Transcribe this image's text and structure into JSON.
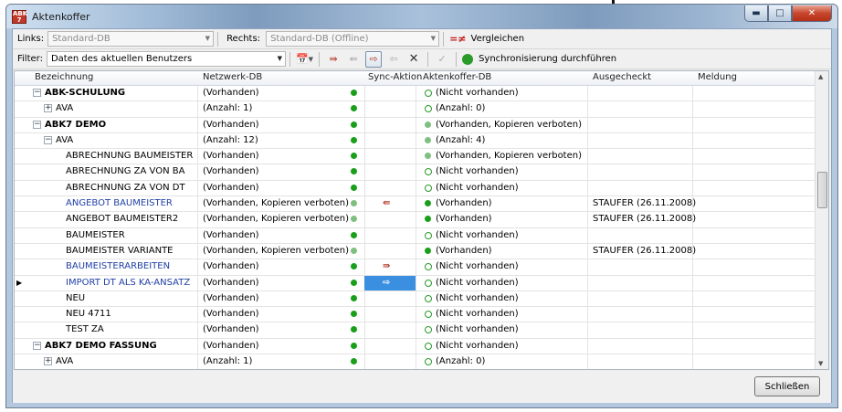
{
  "window": {
    "title": "Aktenkoffer",
    "icon": "abk-app-icon",
    "min": "▬",
    "max": "□",
    "close": "✕"
  },
  "toolbar": {
    "links_label": "Links:",
    "links_value": "Standard-DB",
    "rechts_label": "Rechts:",
    "rechts_value": "Standard-DB (Offline)",
    "compare_label": "Vergleichen",
    "compare_glyph": "=≠",
    "filter_label": "Filter:",
    "filter_value": "Daten des aktuellen Benutzers",
    "sync_label": "Synchronisierung durchführen"
  },
  "columns": [
    "Bezeichnung",
    "Netzwerk-DB",
    "Sync-Aktion",
    "Aktenkoffer-DB",
    "Ausgecheckt",
    "Meldung"
  ],
  "rows": [
    {
      "name": "ABK-SCHULUNG",
      "level": 0,
      "toggle": "⊟",
      "style": "bold",
      "net": "(Vorhanden)",
      "net_dot": "g",
      "sync": "",
      "sync_active": false,
      "ak": "(Nicht vorhanden)",
      "ak_dot": "ring",
      "out": "",
      "msg": ""
    },
    {
      "name": "AVA",
      "level": 1,
      "toggle": "⊞",
      "style": "",
      "net": "(Anzahl: 1)",
      "net_dot": "g",
      "sync": "",
      "sync_active": false,
      "ak": "(Anzahl: 0)",
      "ak_dot": "ring",
      "out": "",
      "msg": ""
    },
    {
      "name": "ABK7 DEMO",
      "level": 0,
      "toggle": "⊟",
      "style": "bold",
      "net": "(Vorhanden)",
      "net_dot": "g",
      "sync": "",
      "sync_active": false,
      "ak": "(Vorhanden, Kopieren verboten)",
      "ak_dot": "p",
      "out": "",
      "msg": ""
    },
    {
      "name": "AVA",
      "level": 1,
      "toggle": "⊟",
      "style": "",
      "net": "(Anzahl: 12)",
      "net_dot": "g",
      "sync": "",
      "sync_active": false,
      "ak": "(Anzahl: 4)",
      "ak_dot": "p",
      "out": "",
      "msg": ""
    },
    {
      "name": "ABRECHNUNG BAUMEISTER",
      "level": 2,
      "toggle": "",
      "style": "",
      "net": "(Vorhanden)",
      "net_dot": "g",
      "sync": "",
      "sync_active": false,
      "ak": "(Vorhanden, Kopieren verboten)",
      "ak_dot": "p",
      "out": "",
      "msg": ""
    },
    {
      "name": "ABRECHNUNG ZA VON BA",
      "level": 2,
      "toggle": "",
      "style": "",
      "net": "(Vorhanden)",
      "net_dot": "g",
      "sync": "",
      "sync_active": false,
      "ak": "(Nicht vorhanden)",
      "ak_dot": "ring",
      "out": "",
      "msg": ""
    },
    {
      "name": "ABRECHNUNG ZA VON DT",
      "level": 2,
      "toggle": "",
      "style": "",
      "net": "(Vorhanden)",
      "net_dot": "g",
      "sync": "",
      "sync_active": false,
      "ak": "(Nicht vorhanden)",
      "ak_dot": "ring",
      "out": "",
      "msg": ""
    },
    {
      "name": "ANGEBOT BAUMEISTER",
      "level": 2,
      "toggle": "",
      "style": "blue",
      "net": "(Vorhanden, Kopieren verboten)",
      "net_dot": "p",
      "sync": "⇚",
      "sync_active": false,
      "ak": "(Vorhanden)",
      "ak_dot": "g",
      "out": "STAUFER (26.11.2008)",
      "msg": ""
    },
    {
      "name": "ANGEBOT BAUMEISTER2",
      "level": 2,
      "toggle": "",
      "style": "",
      "net": "(Vorhanden, Kopieren verboten)",
      "net_dot": "p",
      "sync": "",
      "sync_active": false,
      "ak": "(Vorhanden)",
      "ak_dot": "g",
      "out": "STAUFER (26.11.2008)",
      "msg": ""
    },
    {
      "name": "BAUMEISTER",
      "level": 2,
      "toggle": "",
      "style": "",
      "net": "(Vorhanden)",
      "net_dot": "g",
      "sync": "",
      "sync_active": false,
      "ak": "(Nicht vorhanden)",
      "ak_dot": "ring",
      "out": "",
      "msg": ""
    },
    {
      "name": "BAUMEISTER VARIANTE",
      "level": 2,
      "toggle": "",
      "style": "",
      "net": "(Vorhanden, Kopieren verboten)",
      "net_dot": "p",
      "sync": "",
      "sync_active": false,
      "ak": "(Vorhanden)",
      "ak_dot": "g",
      "out": "STAUFER (26.11.2008)",
      "msg": ""
    },
    {
      "name": "BAUMEISTERARBEITEN",
      "level": 2,
      "toggle": "",
      "style": "blue",
      "net": "(Vorhanden)",
      "net_dot": "g",
      "sync": "⇛",
      "sync_active": false,
      "ak": "(Nicht vorhanden)",
      "ak_dot": "ring",
      "out": "",
      "msg": ""
    },
    {
      "name": "IMPORT DT ALS KA-ANSATZ",
      "level": 2,
      "toggle": "",
      "style": "blue",
      "net": "(Vorhanden)",
      "net_dot": "g",
      "sync": "⇨",
      "sync_active": true,
      "ak": "(Nicht vorhanden)",
      "ak_dot": "ring",
      "out": "",
      "msg": "",
      "selected": true
    },
    {
      "name": "NEU",
      "level": 2,
      "toggle": "",
      "style": "",
      "net": "(Vorhanden)",
      "net_dot": "g",
      "sync": "",
      "sync_active": false,
      "ak": "(Nicht vorhanden)",
      "ak_dot": "ring",
      "out": "",
      "msg": ""
    },
    {
      "name": "NEU 4711",
      "level": 2,
      "toggle": "",
      "style": "",
      "net": "(Vorhanden)",
      "net_dot": "g",
      "sync": "",
      "sync_active": false,
      "ak": "(Nicht vorhanden)",
      "ak_dot": "ring",
      "out": "",
      "msg": ""
    },
    {
      "name": "TEST ZA",
      "level": 2,
      "toggle": "",
      "style": "",
      "net": "(Vorhanden)",
      "net_dot": "g",
      "sync": "",
      "sync_active": false,
      "ak": "(Nicht vorhanden)",
      "ak_dot": "ring",
      "out": "",
      "msg": ""
    },
    {
      "name": "ABK7 DEMO FASSUNG",
      "level": 0,
      "toggle": "⊟",
      "style": "bold",
      "net": "(Vorhanden)",
      "net_dot": "g",
      "sync": "",
      "sync_active": false,
      "ak": "(Nicht vorhanden)",
      "ak_dot": "ring",
      "out": "",
      "msg": ""
    },
    {
      "name": "AVA",
      "level": 1,
      "toggle": "⊞",
      "style": "",
      "net": "(Anzahl: 1)",
      "net_dot": "g",
      "sync": "",
      "sync_active": false,
      "ak": "(Anzahl: 0)",
      "ak_dot": "ring",
      "out": "",
      "msg": ""
    }
  ],
  "footer": {
    "close_label": "Schließen"
  },
  "colors": {
    "selected_sync": "#3a8fe0",
    "dot_green": "#1a9f1a",
    "dot_pale": "#7fbf7f"
  }
}
